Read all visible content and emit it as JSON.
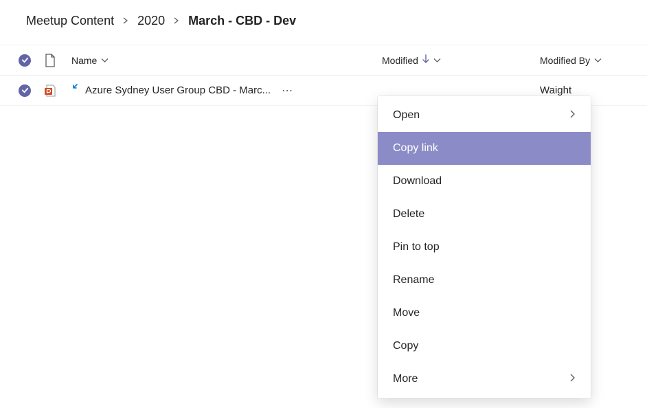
{
  "breadcrumb": [
    {
      "label": "Meetup Content",
      "current": false
    },
    {
      "label": "2020",
      "current": false
    },
    {
      "label": "March - CBD - Dev",
      "current": true
    }
  ],
  "columns": {
    "name": "Name",
    "modified": "Modified",
    "modifiedBy": "Modified By"
  },
  "rows": [
    {
      "name": "Azure Sydney User Group CBD - Marc...",
      "modifiedBy": "Waight"
    }
  ],
  "contextMenu": {
    "highlightIndex": 1,
    "items": [
      {
        "label": "Open",
        "hasSubmenu": true
      },
      {
        "label": "Copy link",
        "hasSubmenu": false
      },
      {
        "label": "Download",
        "hasSubmenu": false
      },
      {
        "label": "Delete",
        "hasSubmenu": false
      },
      {
        "label": "Pin to top",
        "hasSubmenu": false
      },
      {
        "label": "Rename",
        "hasSubmenu": false
      },
      {
        "label": "Move",
        "hasSubmenu": false
      },
      {
        "label": "Copy",
        "hasSubmenu": false
      },
      {
        "label": "More",
        "hasSubmenu": true
      }
    ]
  }
}
